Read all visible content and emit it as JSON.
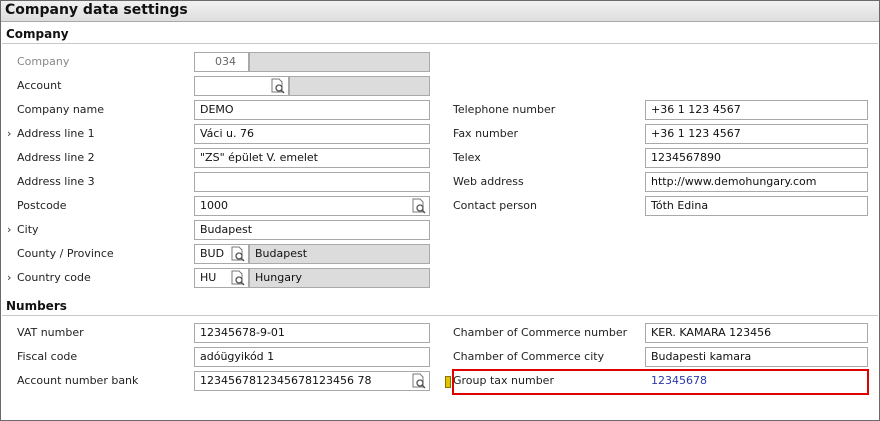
{
  "window": {
    "title": "Company data settings"
  },
  "sections": {
    "company": "Company",
    "numbers": "Numbers"
  },
  "company": {
    "company_label": "Company",
    "company_value": "034",
    "account_label": "Account",
    "account_value": "",
    "name_label": "Company name",
    "name_value": "DEMO",
    "addr1_label": "Address line 1",
    "addr1_value": "Váci u. 76",
    "addr2_label": "Address line 2",
    "addr2_value": "\"ZS\" épület V. emelet",
    "addr3_label": "Address line 3",
    "addr3_value": "",
    "postcode_label": "Postcode",
    "postcode_value": "1000",
    "city_label": "City",
    "city_value": "Budapest",
    "county_label": "County / Province",
    "county_code": "BUD",
    "county_name": "Budapest",
    "country_label": "Country code",
    "country_code": "HU",
    "country_name": "Hungary",
    "phone_label": "Telephone number",
    "phone_value": "+36 1 123 4567",
    "fax_label": "Fax number",
    "fax_value": "+36 1 123 4567",
    "telex_label": "Telex",
    "telex_value": "1234567890",
    "web_label": "Web address",
    "web_value": "http://www.demohungary.com",
    "contact_label": "Contact person",
    "contact_value": "Tóth Edina"
  },
  "numbers": {
    "vat_label": "VAT number",
    "vat_value": "12345678-9-01",
    "fiscal_label": "Fiscal code",
    "fiscal_value": "adóügyikód 1",
    "bank_label": "Account number bank",
    "bank_value": "1234567812345678123456 78",
    "coc_label": "Chamber of Commerce number",
    "coc_value": "KER. KAMARA 123456",
    "coc_city_label": "Chamber of Commerce city",
    "coc_city_value": "Budapesti kamara",
    "group_tax_label": "Group tax number",
    "group_tax_value": "12345678"
  },
  "icons": {
    "lookup": "magnifier-document-icon",
    "expand": "chevron-right-icon"
  }
}
